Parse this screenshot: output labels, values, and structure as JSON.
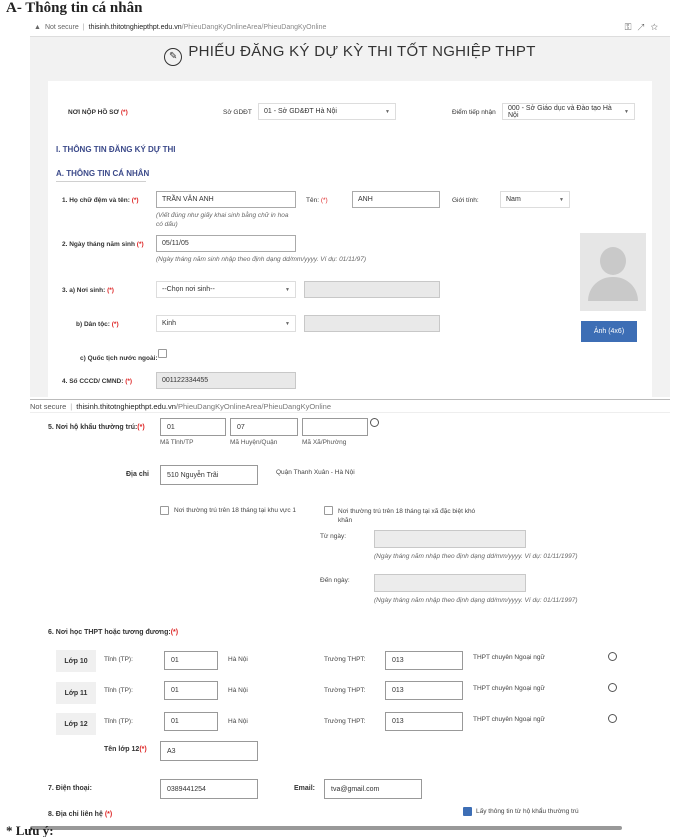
{
  "heading": "A- Thông tin cá nhân",
  "footer_text": "* Lưu ý:",
  "browser1": {
    "not_secure": "Not secure",
    "host": "thisinh.thitotnghiepthpt.edu.vn",
    "path": "/PhieuDangKyOnlineArea/PhieuDangKyOnline"
  },
  "browser2": {
    "not_secure": "Not secure",
    "host": "thisinh.thitotnghiepthpt.edu.vn",
    "path": "/PhieuDangKyOnlineArea/PhieuDangKyOnline"
  },
  "form_title": "PHIẾU ĐĂNG KÝ DỰ KỲ THI TỐT NGHIỆP THPT",
  "top_row": {
    "noi_nop_label": "NƠI NỘP HỒ SƠ",
    "so_gddt_label": "Sở GDĐT",
    "so_gddt_value": "01 - Sở GD&ĐT Hà Nội",
    "diem_tiep_nhan_label": "Điểm tiếp nhận",
    "diem_tiep_nhan_value": "000 - Sở Giáo dục và Đào tạo Hà Nội"
  },
  "section_1": "I. THÔNG TIN ĐĂNG KÝ DỰ THI",
  "section_a": "A. THÔNG TIN CÁ NHÂN",
  "ho_ten": {
    "label": "1. Họ chữ đệm và tên:",
    "value": "TRẦN VĂN ANH",
    "hint": "(Viết đúng như giấy khai sinh bằng chữ in hoa có dấu)",
    "ten_label": "Tên:",
    "ten_value": "ANH",
    "gioi_tinh_label": "Giới tính:",
    "gioi_tinh_value": "Nam"
  },
  "ngay_sinh": {
    "label": "2. Ngày tháng năm sinh",
    "value": "05/11/05",
    "hint": "(Ngày tháng năm sinh nhập theo định dạng dd/mm/yyyy. Ví dụ: 01/11/97)"
  },
  "noi_sinh": {
    "label": "3. a) Nơi sinh:",
    "value": "--Chọn nơi sinh--"
  },
  "dan_toc": {
    "label": "b) Dân tộc:",
    "value": "Kinh"
  },
  "quoc_tich": {
    "label": "c) Quốc tịch nước ngoài:"
  },
  "cccd": {
    "label": "4. Số CCCD/ CMND:",
    "value": "001122334455"
  },
  "photo_button": "Ảnh (4x6)",
  "ho_khau": {
    "label": "5. Nơi hộ khẩu thường trú:",
    "tinh": "01",
    "huyen": "07",
    "xa": "",
    "tinh_label": "Mã Tỉnh/TP",
    "huyen_label": "Mã Huyện/Quận",
    "xa_label": "Mã Xã/Phường",
    "dia_chi_label": "Địa chỉ",
    "dia_chi_value": "510 Nguyễn Trãi",
    "dia_chi_text": "Quận Thanh Xuân - Hà Nội",
    "kv1_label": "Nơi thường trú trên 18 tháng tại khu vực 1",
    "dbkk_label": "Nơi thường trú trên 18 tháng tại xã đặc biệt khó khăn",
    "tu_ngay_label": "Từ ngày:",
    "den_ngay_label": "Đến ngày:",
    "date_hint": "(Ngày tháng năm nhập theo định dạng dd/mm/yyyy. Ví dụ: 01/11/1997)"
  },
  "noi_hoc": {
    "label": "6. Nơi học THPT hoặc tương đương:",
    "tinh_label": "Tỉnh (TP):",
    "truong_label": "Trường THPT:",
    "rows": [
      {
        "lop": "Lớp 10",
        "tinh": "01",
        "tinh_name": "Hà Nội",
        "truong": "013",
        "truong_name": "THPT chuyên Ngoại ngữ"
      },
      {
        "lop": "Lớp 11",
        "tinh": "01",
        "tinh_name": "Hà Nội",
        "truong": "013",
        "truong_name": "THPT chuyên Ngoại ngữ"
      },
      {
        "lop": "Lớp 12",
        "tinh": "01",
        "tinh_name": "Hà Nội",
        "truong": "013",
        "truong_name": "THPT chuyên Ngoại ngữ"
      }
    ],
    "ten_lop_label": "Tên lớp 12",
    "ten_lop_value": "A3"
  },
  "dien_thoai": {
    "label": "7. Điện thoại:",
    "value": "0389441254"
  },
  "email": {
    "label": "Email:",
    "value": "tva@gmail.com"
  },
  "lien_he": {
    "label": "8. Địa chỉ liên hệ",
    "checkbox_label": "Lấy thông tin từ hộ khẩu thường trú"
  },
  "required_mark": "(*)",
  "colors": {
    "accent": "#3d6eb5",
    "required": "#dd2222",
    "section": "#3c4a8a"
  }
}
